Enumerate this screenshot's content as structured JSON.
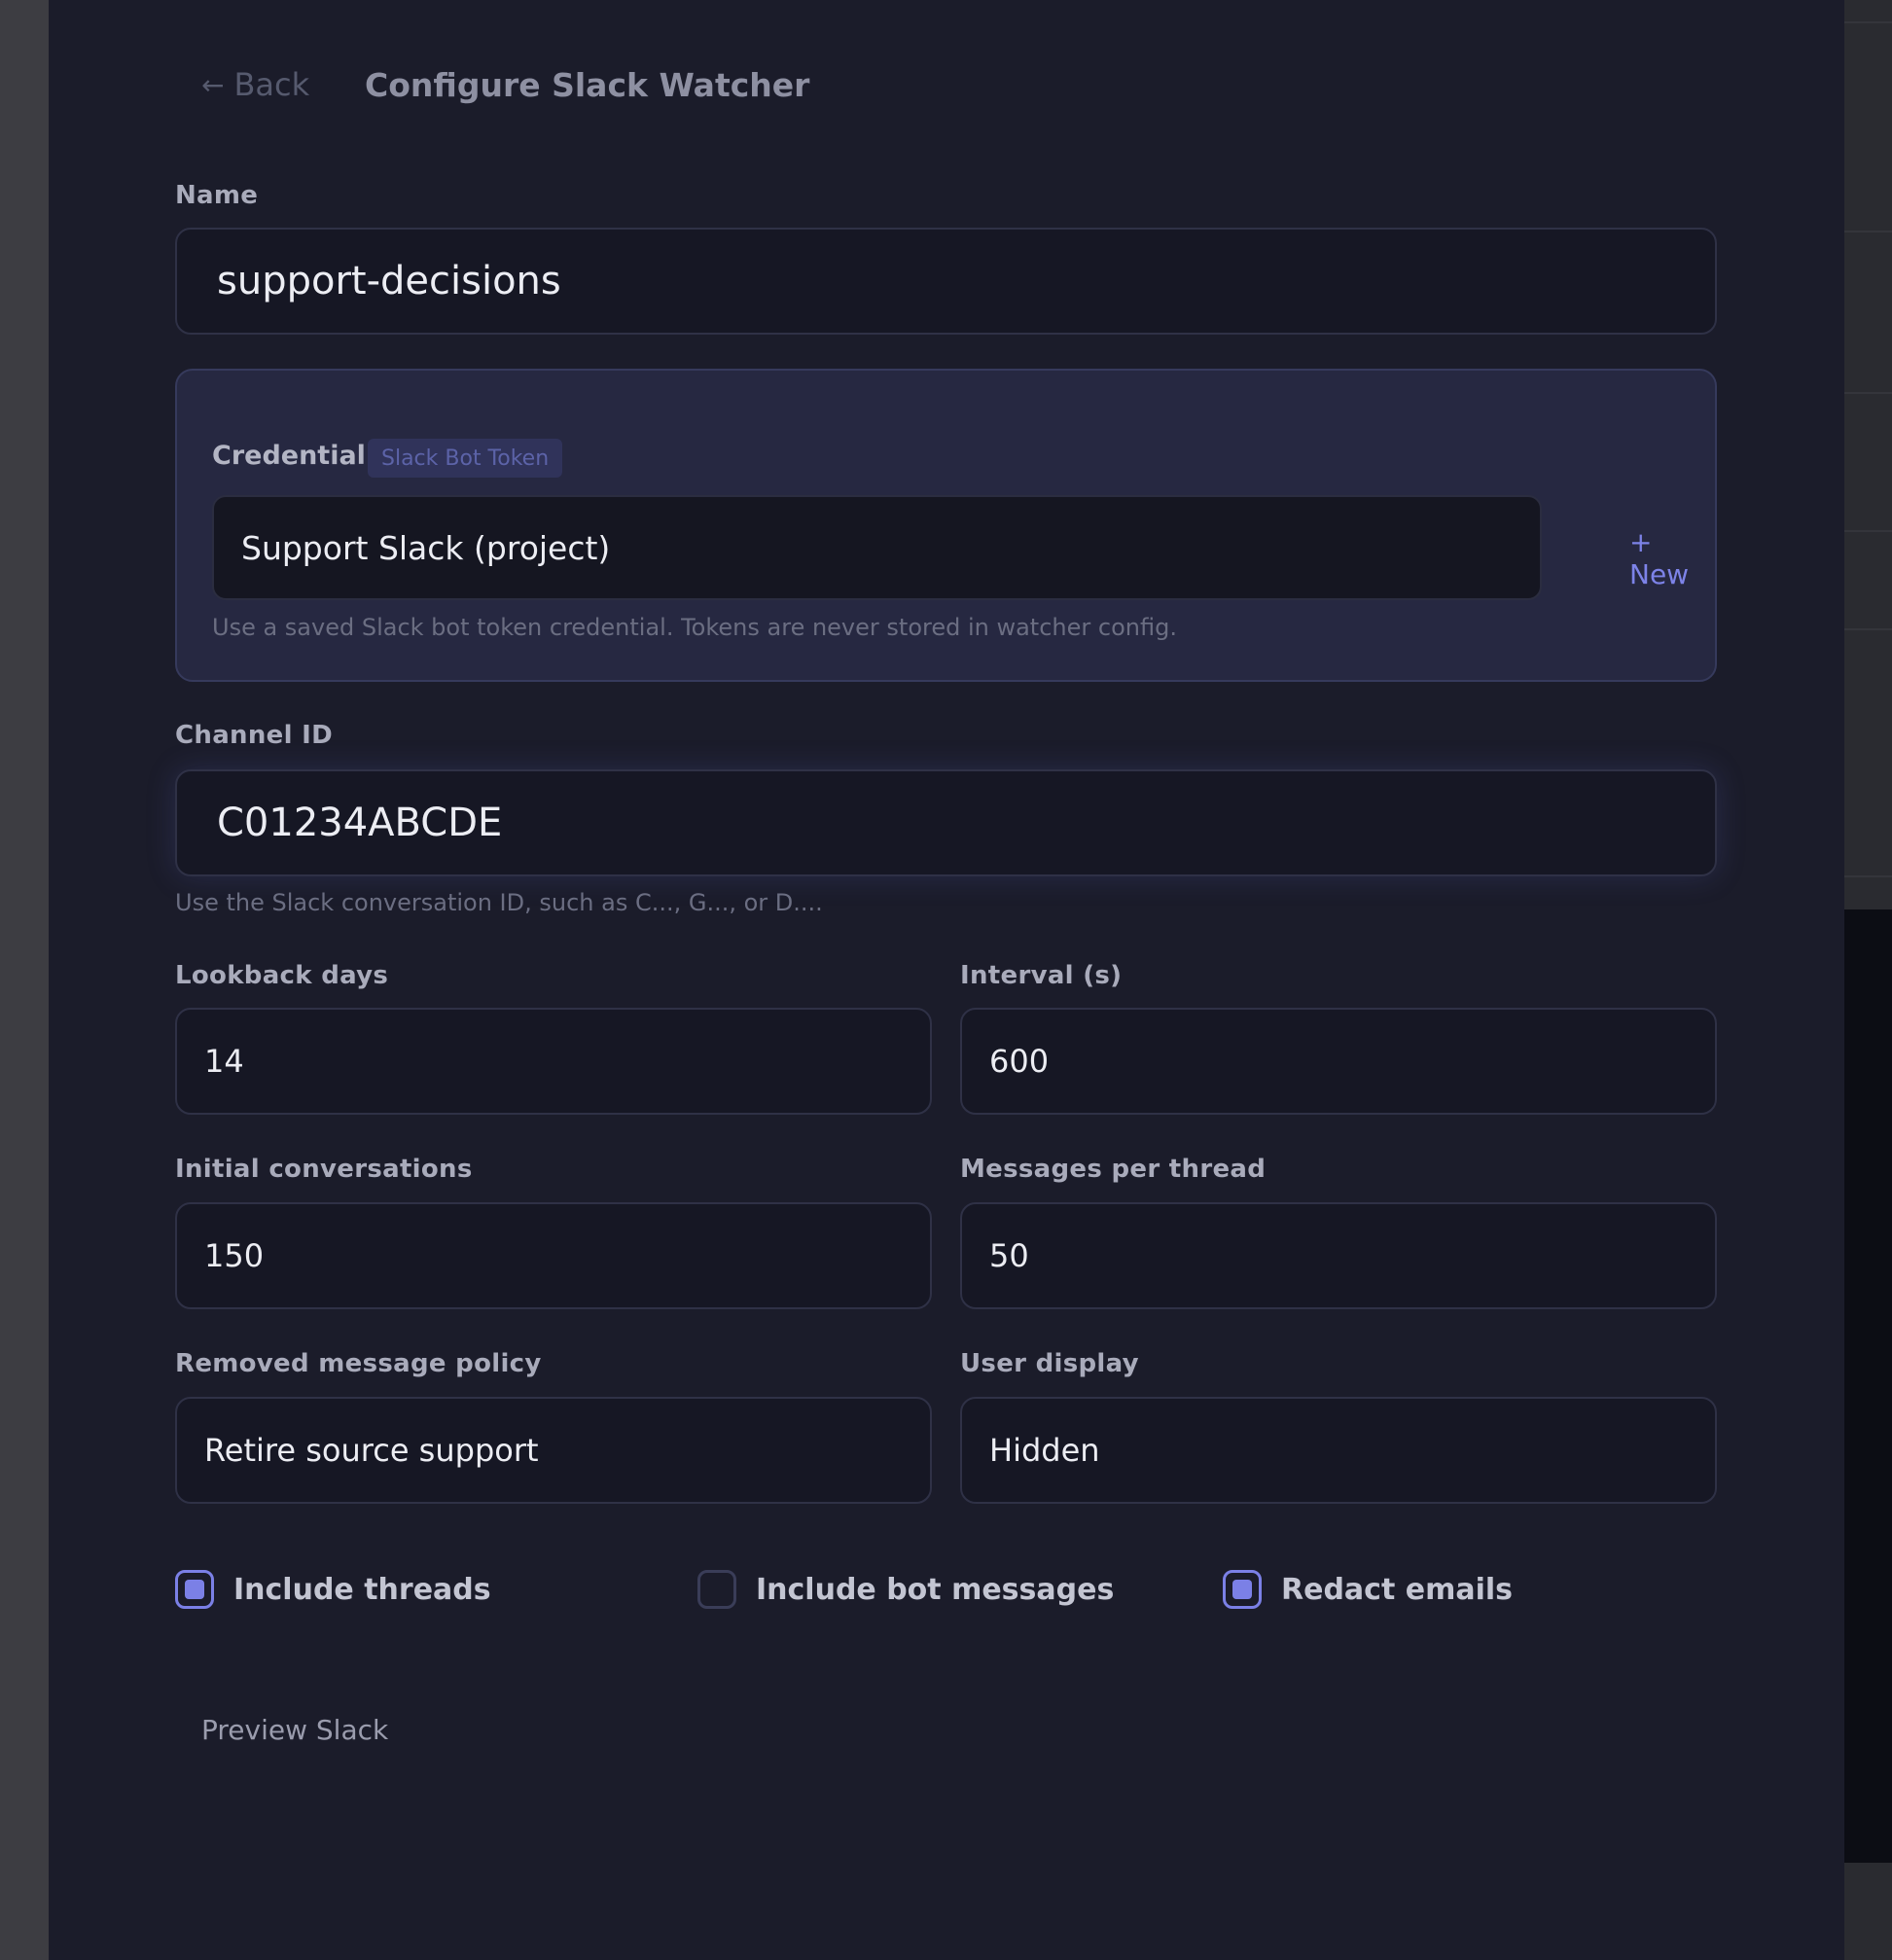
{
  "header": {
    "back_label": "Back",
    "title": "Configure Slack Watcher"
  },
  "fields": {
    "name": {
      "label": "Name",
      "value": "support-decisions"
    },
    "credential": {
      "label": "Credential",
      "badge": "Slack Bot Token",
      "value": "Support Slack (project)",
      "new_label": "+ New",
      "help": "Use a saved Slack bot token credential. Tokens are never stored in watcher config."
    },
    "channel_id": {
      "label": "Channel ID",
      "value": "C01234ABCDE",
      "help": "Use the Slack conversation ID, such as C..., G..., or D...."
    },
    "lookback_days": {
      "label": "Lookback days",
      "value": "14"
    },
    "interval": {
      "label": "Interval (s)",
      "value": "600"
    },
    "initial_conversations": {
      "label": "Initial conversations",
      "value": "150"
    },
    "messages_per_thread": {
      "label": "Messages per thread",
      "value": "50"
    },
    "removed_message_policy": {
      "label": "Removed message policy",
      "value": "Retire source support"
    },
    "user_display": {
      "label": "User display",
      "value": "Hidden"
    }
  },
  "checkboxes": {
    "include_threads": {
      "label": "Include threads",
      "checked": true
    },
    "include_bot_messages": {
      "label": "Include bot messages",
      "checked": false
    },
    "redact_emails": {
      "label": "Redact emails",
      "checked": true
    }
  },
  "actions": {
    "preview_label": "Preview Slack"
  },
  "colors": {
    "panel_bg": "#1b1c2a",
    "accent": "#7b80e6",
    "input_bg": "#161724"
  }
}
